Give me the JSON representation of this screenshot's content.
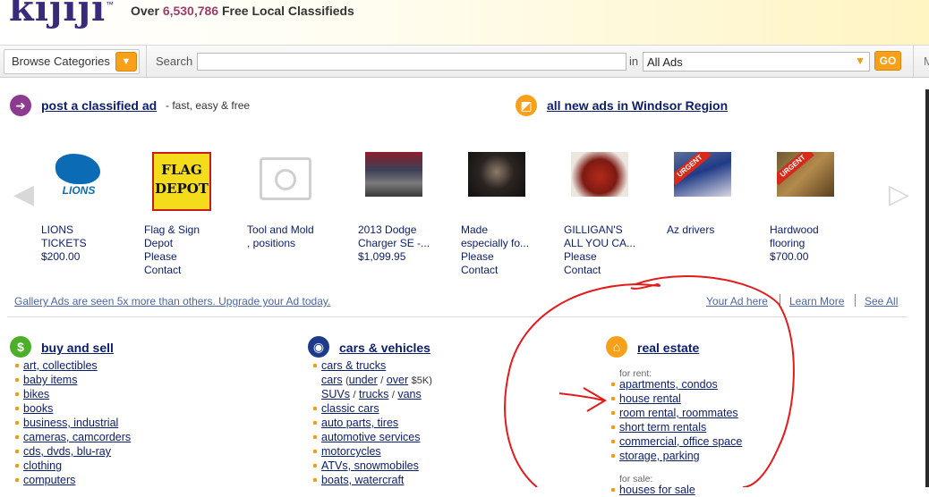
{
  "header": {
    "logo_text": "kijiji",
    "logo_tm": "™",
    "tagline_prefix": "Over",
    "tagline_count": "6,530,786",
    "tagline_suffix": "Free Local Classifieds"
  },
  "searchbar": {
    "browse_label": "Browse Categories",
    "search_label": "Search",
    "search_value": "",
    "in_label": "in",
    "scope_value": "All Ads",
    "go_label": "GO",
    "cut_label": "M"
  },
  "actions": {
    "post_label": "post a classified ad",
    "post_sub": "- fast, easy & free",
    "rss_label": "all new ads in Windsor Region"
  },
  "gallery": {
    "items": [
      {
        "lines": [
          "LIONS",
          "TICKETS",
          "$200.00"
        ],
        "thumb_text": "LIONS"
      },
      {
        "lines": [
          "Flag & Sign",
          "Depot",
          "Please",
          "Contact"
        ],
        "thumb_text": "FLAG\nDEPOT"
      },
      {
        "lines": [
          "Tool and Mold",
          ", positions"
        ]
      },
      {
        "lines": [
          "2013 Dodge",
          "Charger SE -...",
          "$1,099.95"
        ]
      },
      {
        "lines": [
          "Made",
          "especially fo...",
          "Please",
          "Contact"
        ]
      },
      {
        "lines": [
          "GILLIGAN'S",
          "ALL YOU CA...",
          "Please",
          "Contact"
        ]
      },
      {
        "lines": [
          "Az drivers"
        ],
        "badge": "URGENT"
      },
      {
        "lines": [
          "Hardwood",
          "flooring",
          "$700.00"
        ],
        "badge": "URGENT"
      }
    ],
    "note": "Gallery Ads are seen 5x more than others. Upgrade your Ad today.",
    "your_ad": "Your Ad here",
    "learn_more": "Learn More",
    "see_all": "See All"
  },
  "categories": {
    "buy_sell": {
      "title": "buy and sell",
      "items": [
        "art, collectibles",
        "baby items",
        "bikes",
        "books",
        "business, industrial",
        "cameras, camcorders",
        "cds, dvds, blu-ray",
        "clothing",
        "computers"
      ]
    },
    "cars": {
      "title": "cars & vehicles",
      "item0": "cars & trucks",
      "cars": "cars",
      "under": "under",
      "over": "over",
      "price": "$5K",
      "suvs": "SUVs",
      "trucks": "trucks",
      "vans": "vans",
      "items": [
        "classic cars",
        "auto parts, tires",
        "automotive services",
        "motorcycles",
        "ATVs, snowmobiles",
        "boats, watercraft"
      ]
    },
    "real_estate": {
      "title": "real estate",
      "for_rent_label": "for rent:",
      "rent_items": [
        "apartments, condos",
        "house rental",
        "room rental, roommates",
        "short term rentals",
        "commercial, office space",
        "storage, parking"
      ],
      "for_sale_label": "for sale:",
      "sale_items": [
        "houses for sale"
      ]
    }
  },
  "annotation": {
    "stroke_color": "#e21b1b"
  },
  "colors": {
    "accent": "#f7a11a",
    "link": "#0b1d6b",
    "brand": "#3a2a7a"
  }
}
